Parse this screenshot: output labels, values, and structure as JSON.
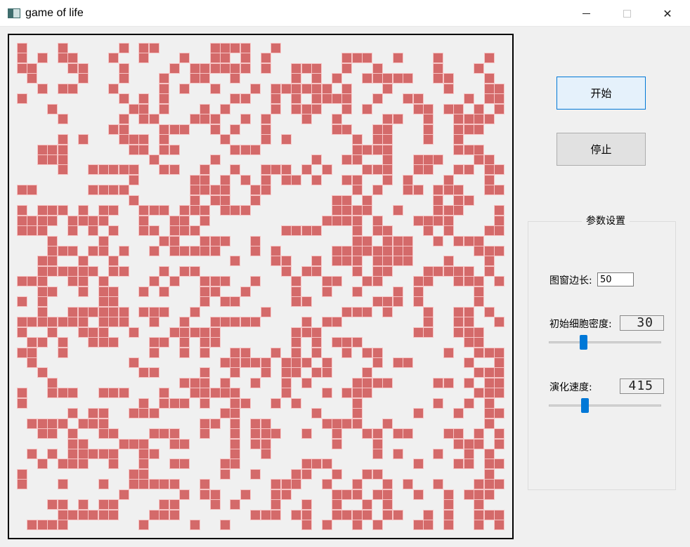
{
  "window": {
    "title": "game of life",
    "minimize_icon": "minimize-icon",
    "maximize_icon": "maximize-icon",
    "close_icon": "close-icon",
    "close_glyph": "✕"
  },
  "board": {
    "grid_size": 48,
    "colors": {
      "alive": "#d46a6a",
      "alive_edge": "#f7c5c5",
      "background": "#f0f0f0"
    },
    "rows": [
      "X...X.....X.XX.....XXXX..X......................",
      "X.X.XX...X..X...X..XX.X.X.......XXX..X...X....X.",
      "XX...XX...X....X.XXXXXX.X..XXX..X..X.....X...X..",
      ".X....X...X...X..XX..X.....X.X.X..XXXXX..XX...X.",
      "..X.XX...X....X.X..X...X.XXXXXX.X...X.....X...XX",
      "X.........X.X.X......XX..X.X.XXXX..X..XX....X.XX",
      "...X.......XX.X...X.X....X.XXX..X.X....XX.XX.X.X",
      "....X.....X.XX...XXX..X.X...X..X....XX..X..XXXX.",
      ".........XX...XXX..X.X..X......XX..XX...X..XXX..",
      "....X.X...XXX.X.....X...X.X......X.XX...X..X....",
      "..XXX......XX.XX.....XXX.........XXXX......XXX..",
      "..XXX........X.....X.........X..XX..X..XXX...XX.",
      "....X..XXXXX..XX..X..X..XXX.X.X...XXX..XX..XX.XX",
      "...........X.....XX.X.X.X.XX.X..XX..X.X...X...X.",
      "XX.....XXXX......XXXX..XX........X.X..XX.XXX..XX",
      "...........X.....X.XX..X.......XX.X......X.XX...",
      "X.XXX.X.XX..XXX.XXX.XXX........XXXX..X...XXX...X",
      "XXXX.XXXX...X..XX.X...........XXXX.X...XXXX....X",
      "XXX..X.X.X..XX.XXX........XXXX...X.XX...X.X...XX",
      "...X....X.....XX..XXX..X.........XX.XXX..X.XXX..",
      "...XXX.XX.X..X.XXXXX...X.X.....XXXXXXXX......XXX",
      "..XX..X..X...........X...XX..X.XXX.XXXX...X...X.",
      "..XXXXXX.XX...X.XX........X.XX...X.XX...XXXXX.X.",
      "XXX..XX.X....X.X..XXX..X...X..XX..XX...XX..XXX.X",
      "..XX..X.XX..X.X...XX..X....X..X..X...X.X.....X..",
      "X.X.....XX........X.XX.....XX......XXX.X.....X..",
      "..X..XXXXXX.XXX..X......X.......XXX.X...X..XX.X.",
      "XXXXXXX.XXX..X..X..XXXXX....X.XX........X..XX..X",
      "X..X..XXX..X...XXXXX.......XXX.........XX..XXX..",
      ".XX.X..XXX...XX.X.XX.......X.X.XXX..........XX..",
      "XX..X........X..X.X..XX..X.X.X..X.XX......X..XXX",
      ".X.........X........XXXXX.XXX.X....X.XX.....X..X",
      "..X.........XX....X..X..X.XX.XX...X..........XXX",
      "...X............XXX.X..X..X.X....XXXX....XX.X.XX",
      "X..XXX..XXX...X..XXXXX....X...X.XXX..........XXX",
      "X...........X.XXX.X..XX..X.X.....X.......X..X.X.",
      ".....X.XX..XXX......XX.......X...X.....X...X..XX",
      ".XXXX.XXX.........XX.X.XX.....XXXX..X.........X.",
      "..XX.X..XX...XXX..X..X.XXX..X..X..XX.XX...XX.X.X",
      ".....XX...XXX..XX....X.XX......X...X.......XXX.X",
      ".X.X.XXXXX..XX.......X..X..........X.X...X..X.X.",
      "..X.XXX..X..X..XX...XX......XXX........X...XX.XX",
      "X..........XX.......X..X...XX..X..XX..........X.",
      "X...X...X..XXXXX..X......XXX..X..X..X.X..X...XXX",
      "..........X.....X.XX..X..XX....XXX.XX..X..X.XXX.",
      "...XX.X.XX....XX...X.X...X..X..X..X.X.....X..X..",
      "....XXXXXX...XXX.......XXX.XX..XXXX.XX..X.X..XXX",
      ".XXXX.......X....X..X.......X.X..X.X...XX.X..X.X"
    ]
  },
  "controls": {
    "start_label": "开始",
    "stop_label": "停止"
  },
  "settings": {
    "group_title": "参数设置",
    "size_label": "图窗边长:",
    "size_value": "50",
    "density_label": "初始细胞密度:",
    "density_display": "30",
    "density_value": 30,
    "speed_label": "演化速度:",
    "speed_display": "415",
    "speed_value_fraction": 0.33,
    "colors": {
      "slider_thumb": "#0078d7",
      "start_border": "#0078d7"
    }
  }
}
